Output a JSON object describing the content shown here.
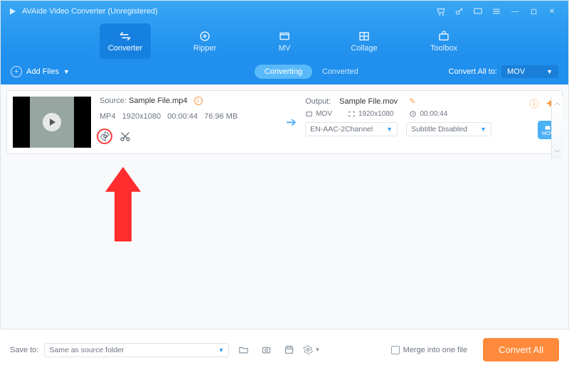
{
  "window": {
    "title": "AVAide Video Converter (Unregistered)"
  },
  "tabs": {
    "converter": "Converter",
    "ripper": "Ripper",
    "mv": "MV",
    "collage": "Collage",
    "toolbox": "Toolbox"
  },
  "toolbar": {
    "add_files": "Add Files",
    "subtab_converting": "Converting",
    "subtab_converted": "Converted",
    "convert_all_to": "Convert All to:",
    "convert_all_format": "MOV"
  },
  "item": {
    "source_label": "Source:",
    "source_name": "Sample File.mp4",
    "info": {
      "codec": "MP4",
      "resolution": "1920x1080",
      "duration": "00:00:44",
      "size": "76.96 MB"
    },
    "output_label": "Output:",
    "output_name": "Sample File.mov",
    "out_format": "MOV",
    "out_resolution": "1920x1080",
    "out_duration": "00:00:44",
    "audio_dd": "EN-AAC-2Channel",
    "subtitle_dd": "Subtitle Disabled",
    "fmt_badge": "MOV"
  },
  "bottom": {
    "save_to": "Save to:",
    "save_path": "Same as source folder",
    "merge": "Merge into one file",
    "convert_all": "Convert All"
  }
}
